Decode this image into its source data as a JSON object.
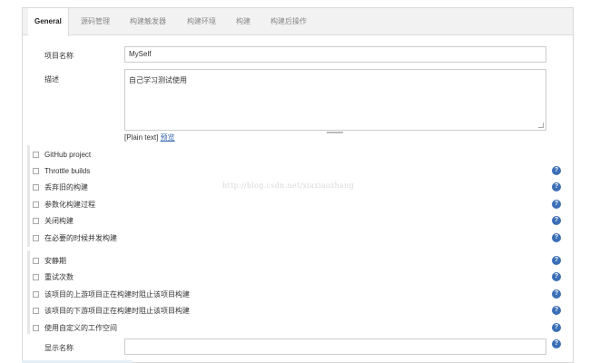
{
  "tabs": [
    {
      "label": "General",
      "active": true
    },
    {
      "label": "源码管理",
      "active": false
    },
    {
      "label": "构建触发器",
      "active": false
    },
    {
      "label": "构建环境",
      "active": false
    },
    {
      "label": "构建",
      "active": false
    },
    {
      "label": "构建后操作",
      "active": false
    }
  ],
  "form": {
    "project_name_label": "项目名称",
    "project_name_value": "MySelf",
    "description_label": "描述",
    "description_value": "自己学习测试使用",
    "plain_text_label": "[Plain text]",
    "preview_link": "预览",
    "display_name_label": "显示名称",
    "display_name_value": ""
  },
  "options_group1": [
    {
      "label": "GitHub project",
      "checked": false,
      "help": false
    },
    {
      "label": "Throttle builds",
      "checked": false,
      "help": true
    },
    {
      "label": "丢弃旧的构建",
      "checked": false,
      "help": true
    },
    {
      "label": "参数化构建过程",
      "checked": false,
      "help": true
    },
    {
      "label": "关闭构建",
      "checked": false,
      "help": true
    },
    {
      "label": "在必要的时候并发构建",
      "checked": false,
      "help": true
    }
  ],
  "options_group2": [
    {
      "label": "安静期",
      "checked": false,
      "help": true
    },
    {
      "label": "重试次数",
      "checked": false,
      "help": true
    },
    {
      "label": "该项目的上游项目正在构建时阻止该项目构建",
      "checked": false,
      "help": true
    },
    {
      "label": "该项目的下游项目正在构建时阻止该项目构建",
      "checked": false,
      "help": true
    },
    {
      "label": "使用自定义的工作空间",
      "checked": false,
      "help": true
    }
  ],
  "help_icon_glyph": "?",
  "watermark": "http://blog.csdn.net/xiaxiaozhang",
  "colors": {
    "help_icon": "#3b6fb6",
    "link": "#3467b0"
  }
}
